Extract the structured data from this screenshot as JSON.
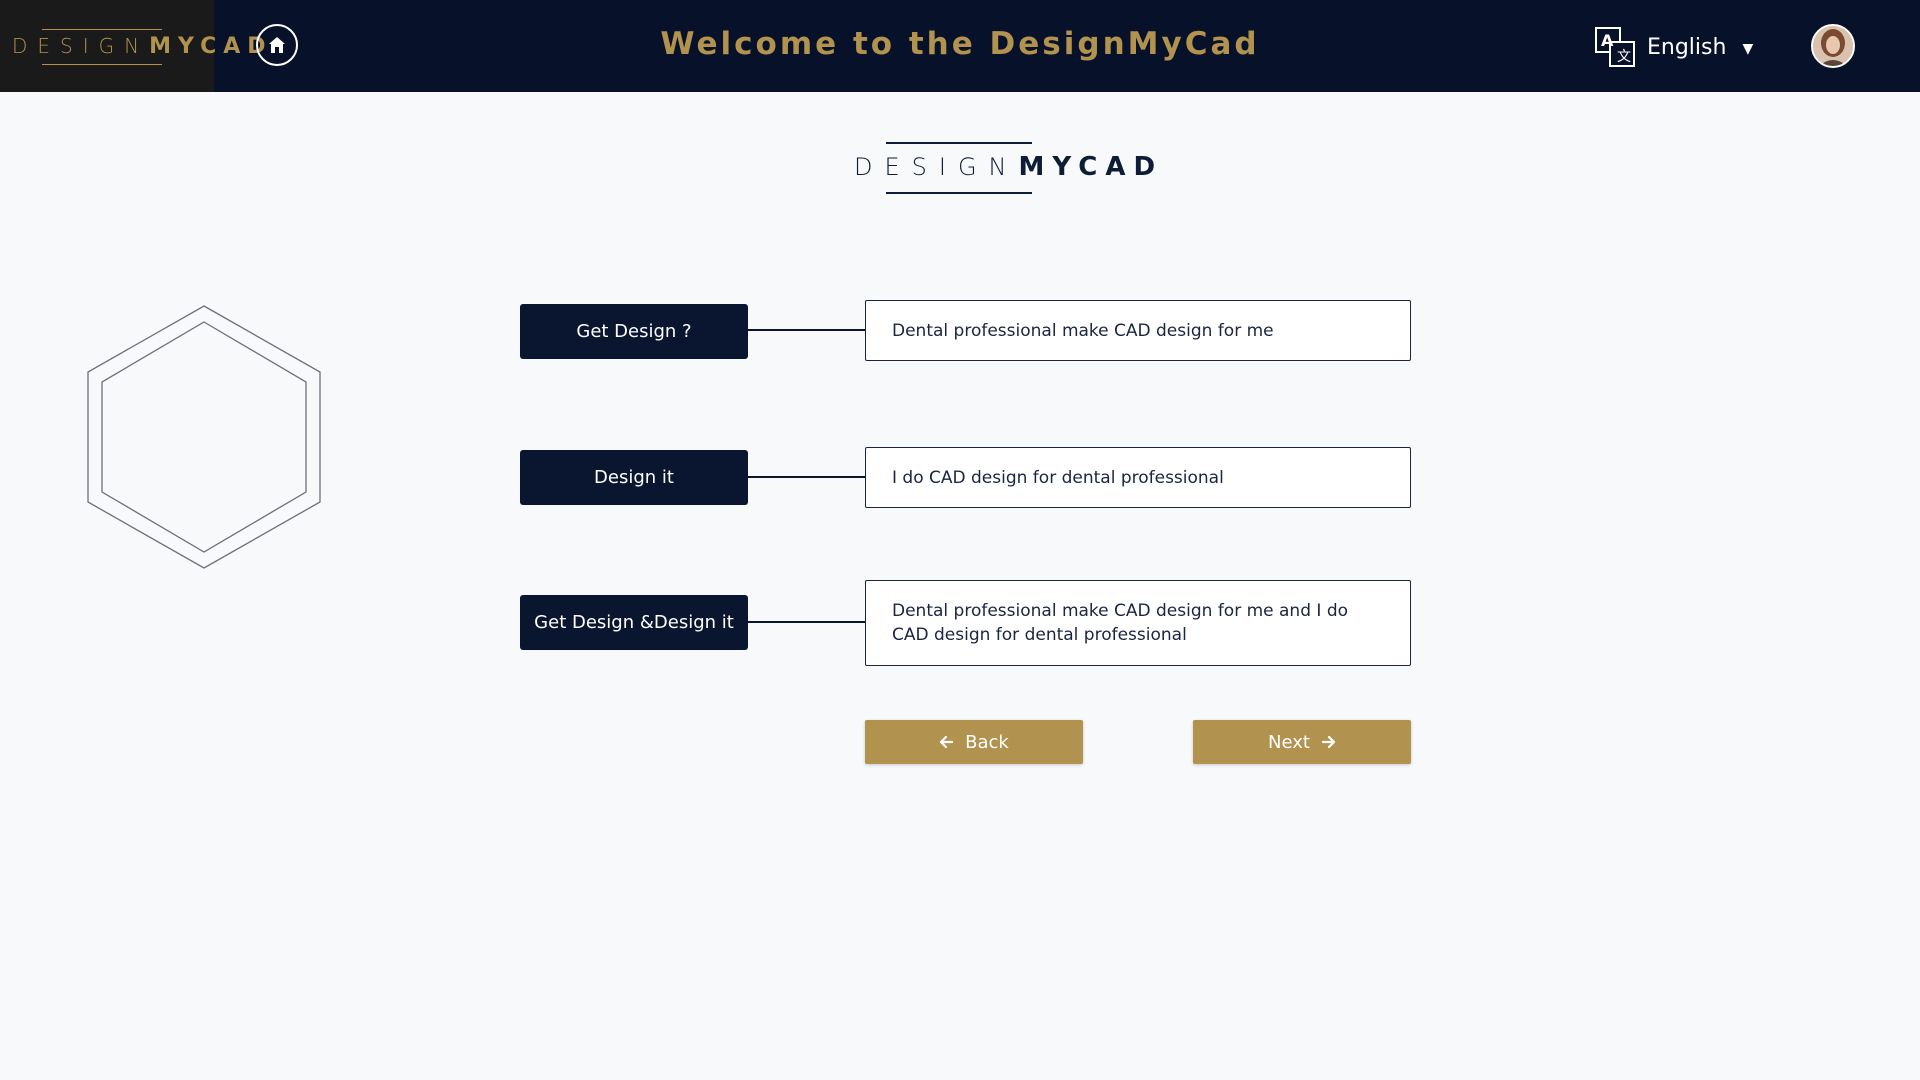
{
  "header": {
    "brand": {
      "thin": "DESIGN",
      "bold": "MYCAD"
    },
    "title": "Welcome to the DesignMyCad",
    "language": "English"
  },
  "logo": {
    "thin": "DESIGN",
    "bold": "MYCAD"
  },
  "options": [
    {
      "label": "Get Design ?",
      "description": "Dental professional make CAD design for me"
    },
    {
      "label": "Design it",
      "description": "I do CAD design for dental professional"
    },
    {
      "label": "Get Design &Design it",
      "description": "Dental professional make CAD design for me and I do CAD design for dental professional"
    }
  ],
  "buttons": {
    "back": "Back",
    "next": "Next"
  },
  "colors": {
    "navy": "#07122a",
    "gold": "#b1924f",
    "background": "#f7f9fb"
  }
}
